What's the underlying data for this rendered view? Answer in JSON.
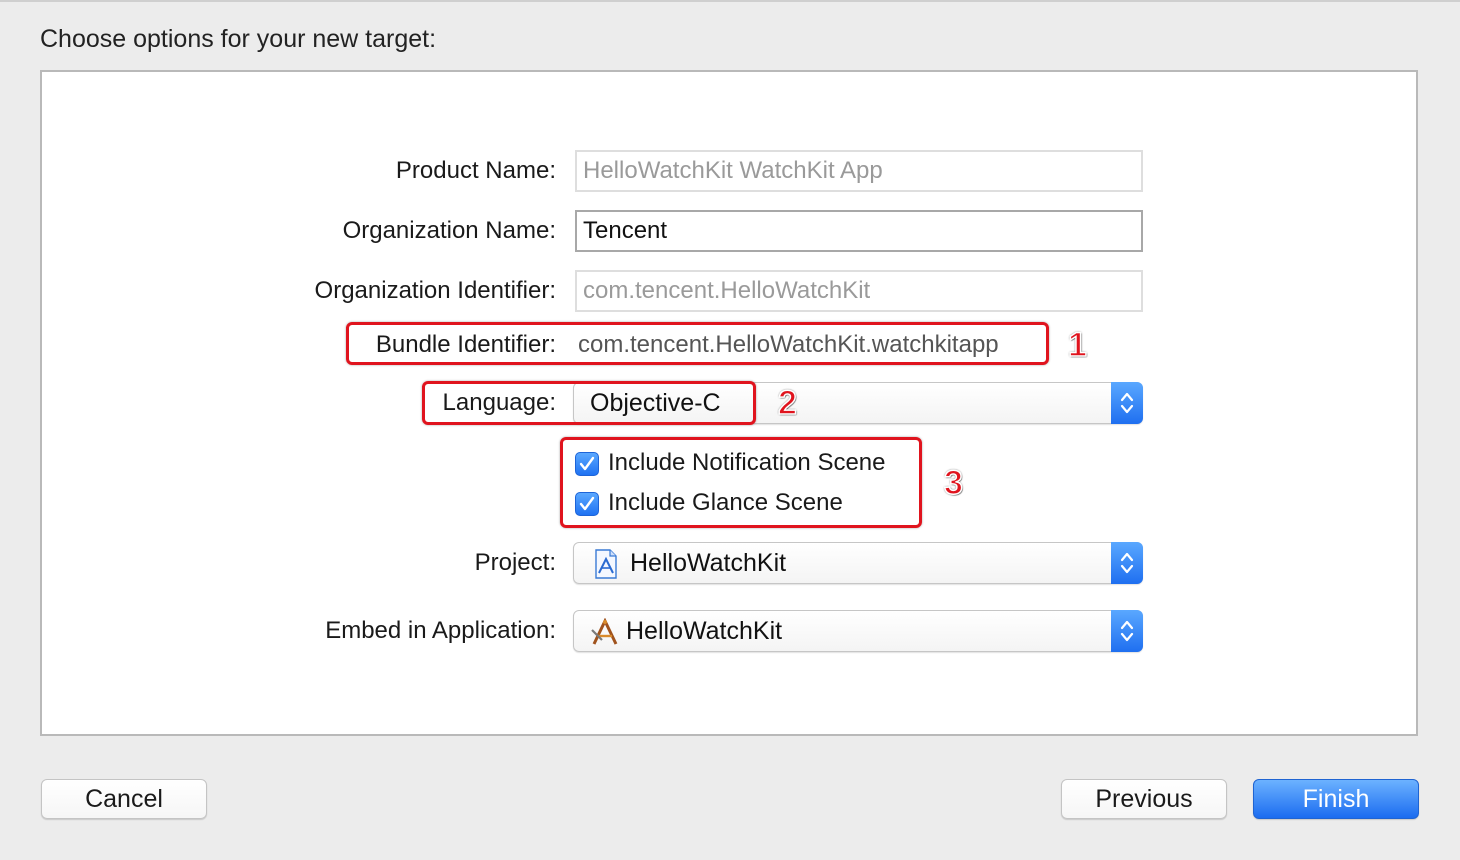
{
  "dialog": {
    "heading": "Choose options for your new target:"
  },
  "form": {
    "product_name": {
      "label": "Product Name:",
      "value": "HelloWatchKit WatchKit App"
    },
    "organization_name": {
      "label": "Organization Name:",
      "value": "Tencent"
    },
    "organization_identifier": {
      "label": "Organization Identifier:",
      "value": "com.tencent.HelloWatchKit"
    },
    "bundle_identifier": {
      "label": "Bundle Identifier:",
      "value": "com.tencent.HelloWatchKit.watchkitapp"
    },
    "language": {
      "label": "Language:",
      "value": "Objective-C"
    },
    "include_notification_scene": {
      "label": "Include Notification Scene",
      "checked": true
    },
    "include_glance_scene": {
      "label": "Include Glance Scene",
      "checked": true
    },
    "project": {
      "label": "Project:",
      "value": "HelloWatchKit",
      "icon": "xcode-project-icon"
    },
    "embed_in_application": {
      "label": "Embed in Application:",
      "value": "HelloWatchKit",
      "icon": "app-icon"
    }
  },
  "annotations": {
    "one": "1",
    "two": "2",
    "three": "3"
  },
  "buttons": {
    "cancel": "Cancel",
    "previous": "Previous",
    "finish": "Finish"
  },
  "colors": {
    "accent": "#1f6ff0",
    "annotation": "#e0141e"
  }
}
